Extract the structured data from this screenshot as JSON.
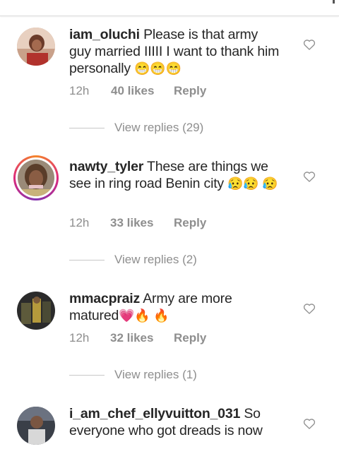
{
  "comments": [
    {
      "username": "iam_oluchi",
      "text": "Please is that army guy married IIIII I want to thank him personally",
      "emoji": "😁😁😁",
      "time": "12h",
      "likes": "40 likes",
      "reply": "Reply",
      "view_replies": "View replies (29)"
    },
    {
      "username": "nawty_tyler",
      "text": "These are things we see in ring road Benin city",
      "emoji": "😥😥 😥",
      "time": "12h",
      "likes": "33 likes",
      "reply": "Reply",
      "view_replies": "View replies (2)"
    },
    {
      "username": "mmacpraiz",
      "text": "Army are more matured",
      "emoji": "💗🔥 🔥",
      "time": "12h",
      "likes": "32 likes",
      "reply": "Reply",
      "view_replies": "View replies (1)"
    },
    {
      "username": "i_am_chef_ellyvuitton_031",
      "text": "So everyone who got dreads is now"
    }
  ],
  "colors": {
    "text": "#262626",
    "secondary": "#8e8e8e",
    "story_ring": "#dd2a7b"
  },
  "icons": {
    "like": "heart-outline-icon"
  }
}
